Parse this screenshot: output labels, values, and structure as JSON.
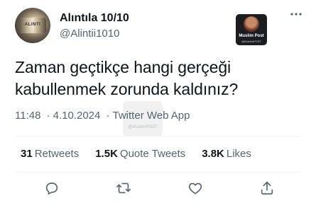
{
  "author": {
    "name": "Alıntıla 10/10",
    "handle": "@Alintii1010",
    "avatar_text": "ALINTI"
  },
  "more_icon": "more-horizontal-icon",
  "badge": {
    "title": "Muslim Post",
    "subtitle": "@MuslimPOST"
  },
  "tweet": {
    "text": "Zaman geçtikçe hangi gerçeği kabullenmek zorunda kaldınız?",
    "time": "11:48",
    "separator": "·",
    "date": "4.10.2024",
    "source": "Twitter Web App"
  },
  "watermark": {
    "text": "@MuslimPOST"
  },
  "stats": [
    {
      "count": "31",
      "label": "Retweets"
    },
    {
      "count": "1.5K",
      "label": "Quote Tweets"
    },
    {
      "count": "3.8K",
      "label": "Likes"
    }
  ],
  "actions": [
    {
      "icon": "reply-icon"
    },
    {
      "icon": "retweet-icon"
    },
    {
      "icon": "like-icon"
    },
    {
      "icon": "share-icon"
    }
  ],
  "colors": {
    "text": "#0f1419",
    "secondary": "#536471",
    "divider": "#eff3f4"
  }
}
